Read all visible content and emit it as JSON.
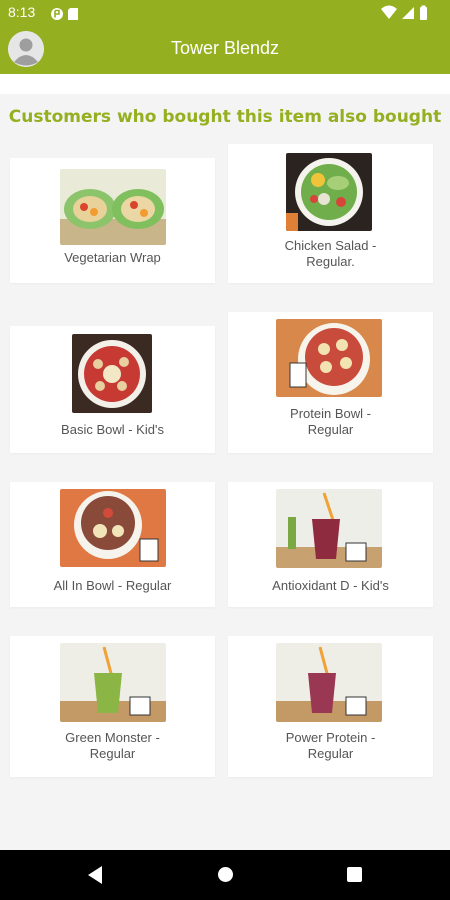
{
  "status_bar": {
    "time": "8:13",
    "left_icons": [
      "app-notification-icon",
      "sd-card-icon"
    ],
    "right_icons": [
      "wifi-icon",
      "signal-icon",
      "battery-icon"
    ]
  },
  "app_bar": {
    "title": "Tower Blendz",
    "avatar_icon": "account-circle-icon",
    "color": "#94af1f"
  },
  "section": {
    "heading": "Customers who bought this item also bought"
  },
  "products": [
    {
      "name": "Vegetarian Wrap",
      "image": "vegetarian-wrap-image"
    },
    {
      "name": "Chicken Salad - Regular.",
      "image": "chicken-salad-image"
    },
    {
      "name": "Basic Bowl - Kid's",
      "image": "basic-bowl-image"
    },
    {
      "name": "Protein Bowl - Regular",
      "image": "protein-bowl-image"
    },
    {
      "name": "All In Bowl - Regular",
      "image": "all-in-bowl-image"
    },
    {
      "name": "Antioxidant D - Kid's",
      "image": "antioxidant-smoothie-image"
    },
    {
      "name": "Green Monster - Regular",
      "image": "green-smoothie-image"
    },
    {
      "name": "Power Protein - Regular",
      "image": "power-protein-smoothie-image"
    }
  ],
  "nav_bar": {
    "icons": [
      "back-icon",
      "home-icon",
      "recent-apps-icon"
    ]
  }
}
